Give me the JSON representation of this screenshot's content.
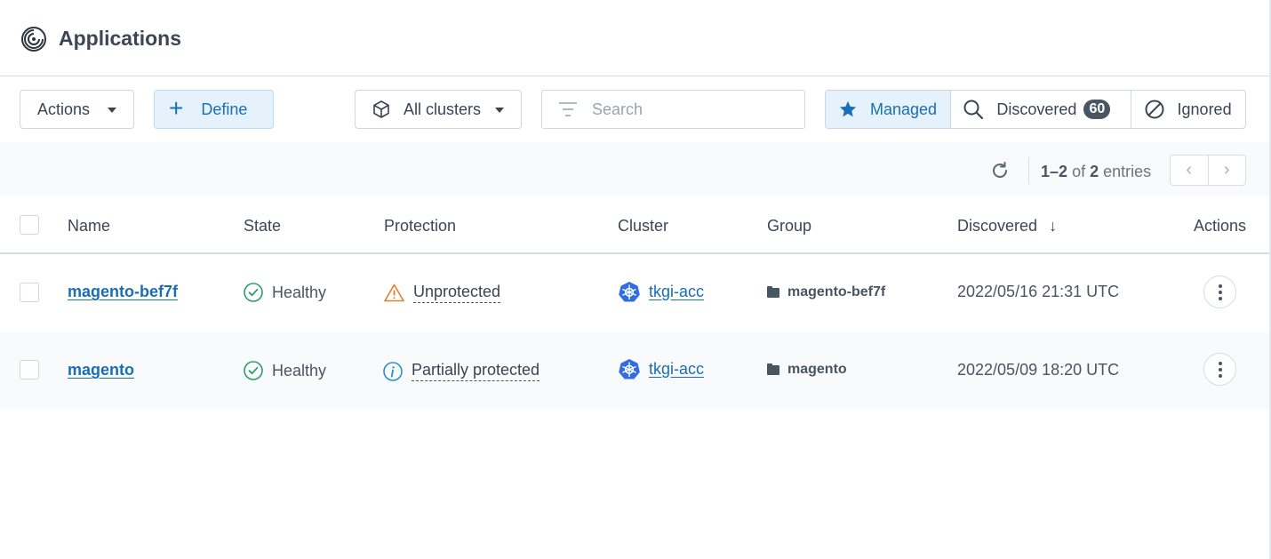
{
  "header": {
    "title": "Applications",
    "icon": "applications-spiral-icon"
  },
  "toolbar": {
    "actions_label": "Actions",
    "define_label": "Define",
    "clusters_label": "All clusters",
    "search_placeholder": "Search",
    "filters": [
      {
        "label": "Managed",
        "icon": "star-icon",
        "selected": true
      },
      {
        "label": "Discovered",
        "icon": "search-icon",
        "count": "60"
      },
      {
        "label": "Ignored",
        "icon": "ignored-icon"
      }
    ]
  },
  "pagination": {
    "range": "1–2",
    "of": "of",
    "total": "2",
    "suffix": "entries"
  },
  "table": {
    "columns": [
      "Name",
      "State",
      "Protection",
      "Cluster",
      "Group",
      "Discovered",
      "Actions"
    ],
    "sort_column": "Discovered",
    "sort_direction": "descending",
    "rows": [
      {
        "name": "magento-bef7f",
        "state": "Healthy",
        "protection": "Unprotected",
        "protection_icon": "warning-icon",
        "cluster": "tkgi-acc",
        "group": "magento-bef7f",
        "discovered": "2022/05/16 21:31 UTC"
      },
      {
        "name": "magento",
        "state": "Healthy",
        "protection": "Partially protected",
        "protection_icon": "info-icon",
        "cluster": "tkgi-acc",
        "group": "magento",
        "discovered": "2022/05/09 18:20 UTC"
      }
    ]
  },
  "colors": {
    "accent": "#1a6eb5",
    "accent_bg": "#e5f2fb",
    "healthy": "#2e9c6a",
    "warning": "#d9822b",
    "info": "#2a8fcf",
    "kubernetes": "#326ce5"
  }
}
